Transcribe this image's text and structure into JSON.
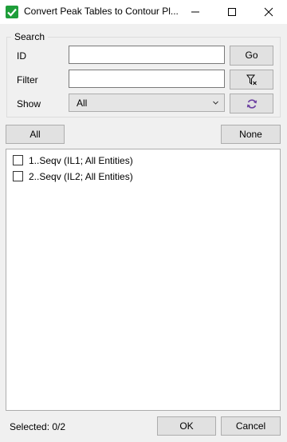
{
  "window": {
    "title": "Convert Peak Tables to Contour Pl...",
    "app_icon": "green-checkmark-icon"
  },
  "search": {
    "group_label": "Search",
    "id_label": "ID",
    "id_value": "",
    "filter_label": "Filter",
    "filter_value": "",
    "show_label": "Show",
    "show_selected": "All",
    "go_label": "Go",
    "clear_filter_icon": "filter-clear-icon",
    "refresh_icon": "refresh-icon"
  },
  "selection": {
    "all_label": "All",
    "none_label": "None"
  },
  "list": {
    "items": [
      {
        "label": "1..Seqv (IL1; All Entities)",
        "checked": false
      },
      {
        "label": "2..Seqv (IL2; All Entities)",
        "checked": false
      }
    ]
  },
  "footer": {
    "status": "Selected: 0/2",
    "ok_label": "OK",
    "cancel_label": "Cancel"
  },
  "colors": {
    "accent": "#1e9e3a",
    "refresh_icon": "#6b3fa0"
  }
}
